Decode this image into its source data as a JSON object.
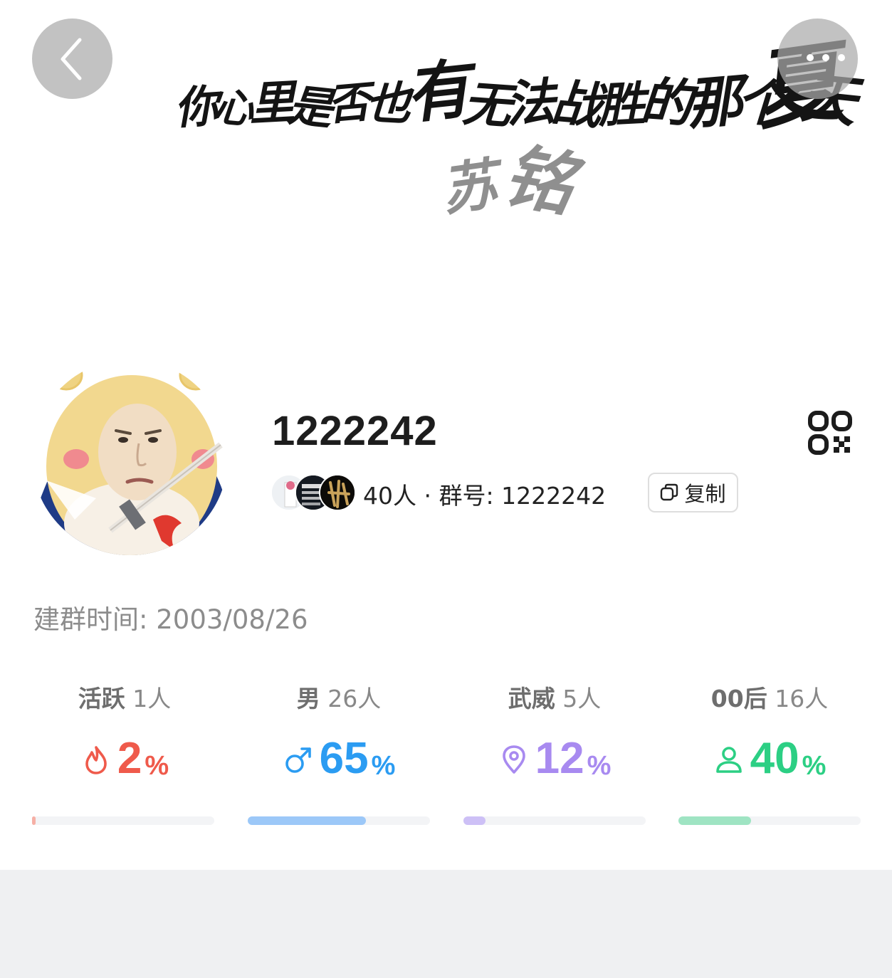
{
  "header": {
    "banner_line": "你心里是否也有无法战胜的那个夏天",
    "banner_sign": "苏铭",
    "icons": {
      "back": "chevron-left-icon",
      "more": "more-dots-icon"
    }
  },
  "group": {
    "name": "1222242",
    "member_count": "40人",
    "separator": "·",
    "group_id_label": "群号:",
    "group_id": "1222242",
    "copy_label": "复制",
    "created_label": "建群时间:",
    "created_date": "2003/08/26"
  },
  "stats": [
    {
      "label": "活跃",
      "count": "1人",
      "percent": "2",
      "unit": "%",
      "fraction": 0.02,
      "color": "#ef5a4b",
      "bar_color": "#f6b0a6",
      "icon": "flame-icon"
    },
    {
      "label": "男",
      "count": "26人",
      "percent": "65",
      "unit": "%",
      "fraction": 0.65,
      "color": "#2b9cf2",
      "bar_color": "#9cc8f8",
      "icon": "male-icon"
    },
    {
      "label": "武威",
      "count": "5人",
      "percent": "12",
      "unit": "%",
      "fraction": 0.12,
      "color": "#a88af0",
      "bar_color": "#cdc0f6",
      "icon": "location-pin-icon"
    },
    {
      "label": "00后",
      "count": "16人",
      "percent": "40",
      "unit": "%",
      "fraction": 0.4,
      "color": "#2ccf84",
      "bar_color": "#9fe4c3",
      "icon": "person-icon"
    }
  ]
}
